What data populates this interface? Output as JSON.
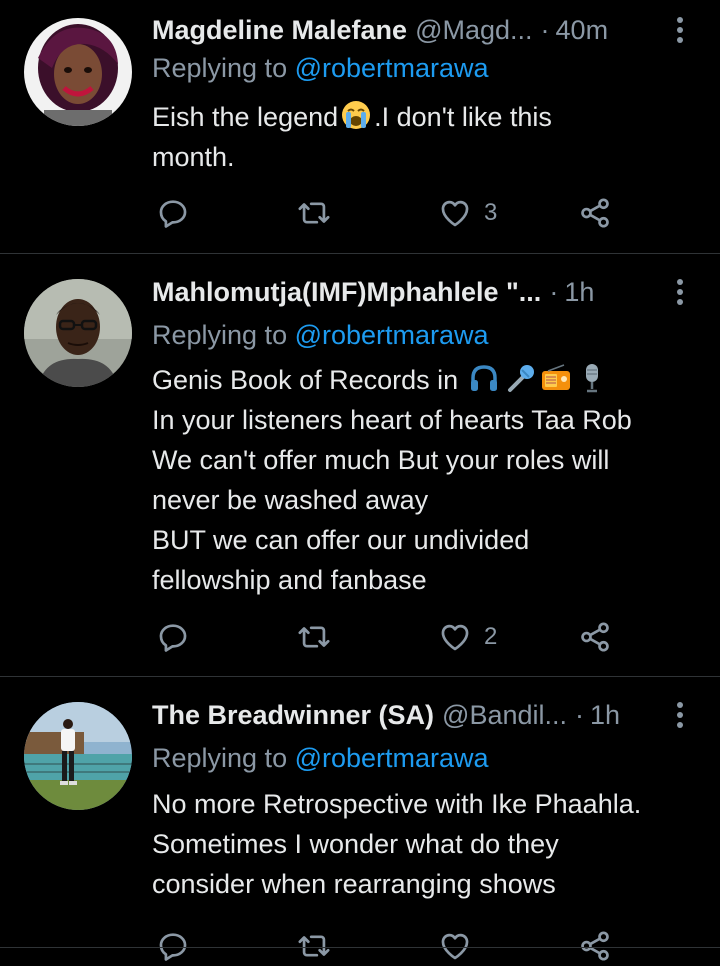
{
  "tweets": [
    {
      "name": "Magdeline Malefane",
      "handle": "@Magd...",
      "time": "40m",
      "reply_prefix": "Replying to ",
      "reply_mention": "@robertmarawa",
      "text_before": "Eish the legend",
      "text_after": ".I don't like this\nmonth.",
      "emoji": "loudly-crying-face",
      "likes": "3"
    },
    {
      "name": "Mahlomutja(IMF)Mphahlele \"...",
      "handle": "",
      "time": "1h",
      "reply_prefix": "Replying to ",
      "reply_mention": "@robertmarawa",
      "text_before": "Genis Book of Records in ",
      "text_after": "In your listeners heart of hearts Taa Rob\nWe can't offer much But your roles will\nnever be washed away\nBUT we can offer our undivided\nfellowship and fanbase",
      "emoji": [
        "headphone",
        "microphone",
        "radio",
        "studio-microphone"
      ],
      "likes": "2"
    },
    {
      "name": "The Breadwinner (SA)",
      "handle": "@Bandil...",
      "time": "1h",
      "reply_prefix": "Replying to ",
      "reply_mention": "@robertmarawa",
      "text": "No more Retrospective with Ike Phaahla.\nSometimes I wonder what do they\nconsider when rearranging shows",
      "likes": ""
    }
  ],
  "icons": {
    "reply": "reply-icon",
    "retweet": "retweet-icon",
    "like": "heart-icon",
    "share": "share-icon",
    "more": "more-icon"
  },
  "colors": {
    "background": "#000000",
    "text": "#e7e9ea",
    "secondary": "#8b98a5",
    "link": "#1d9bf0",
    "divider": "#2f3336"
  }
}
